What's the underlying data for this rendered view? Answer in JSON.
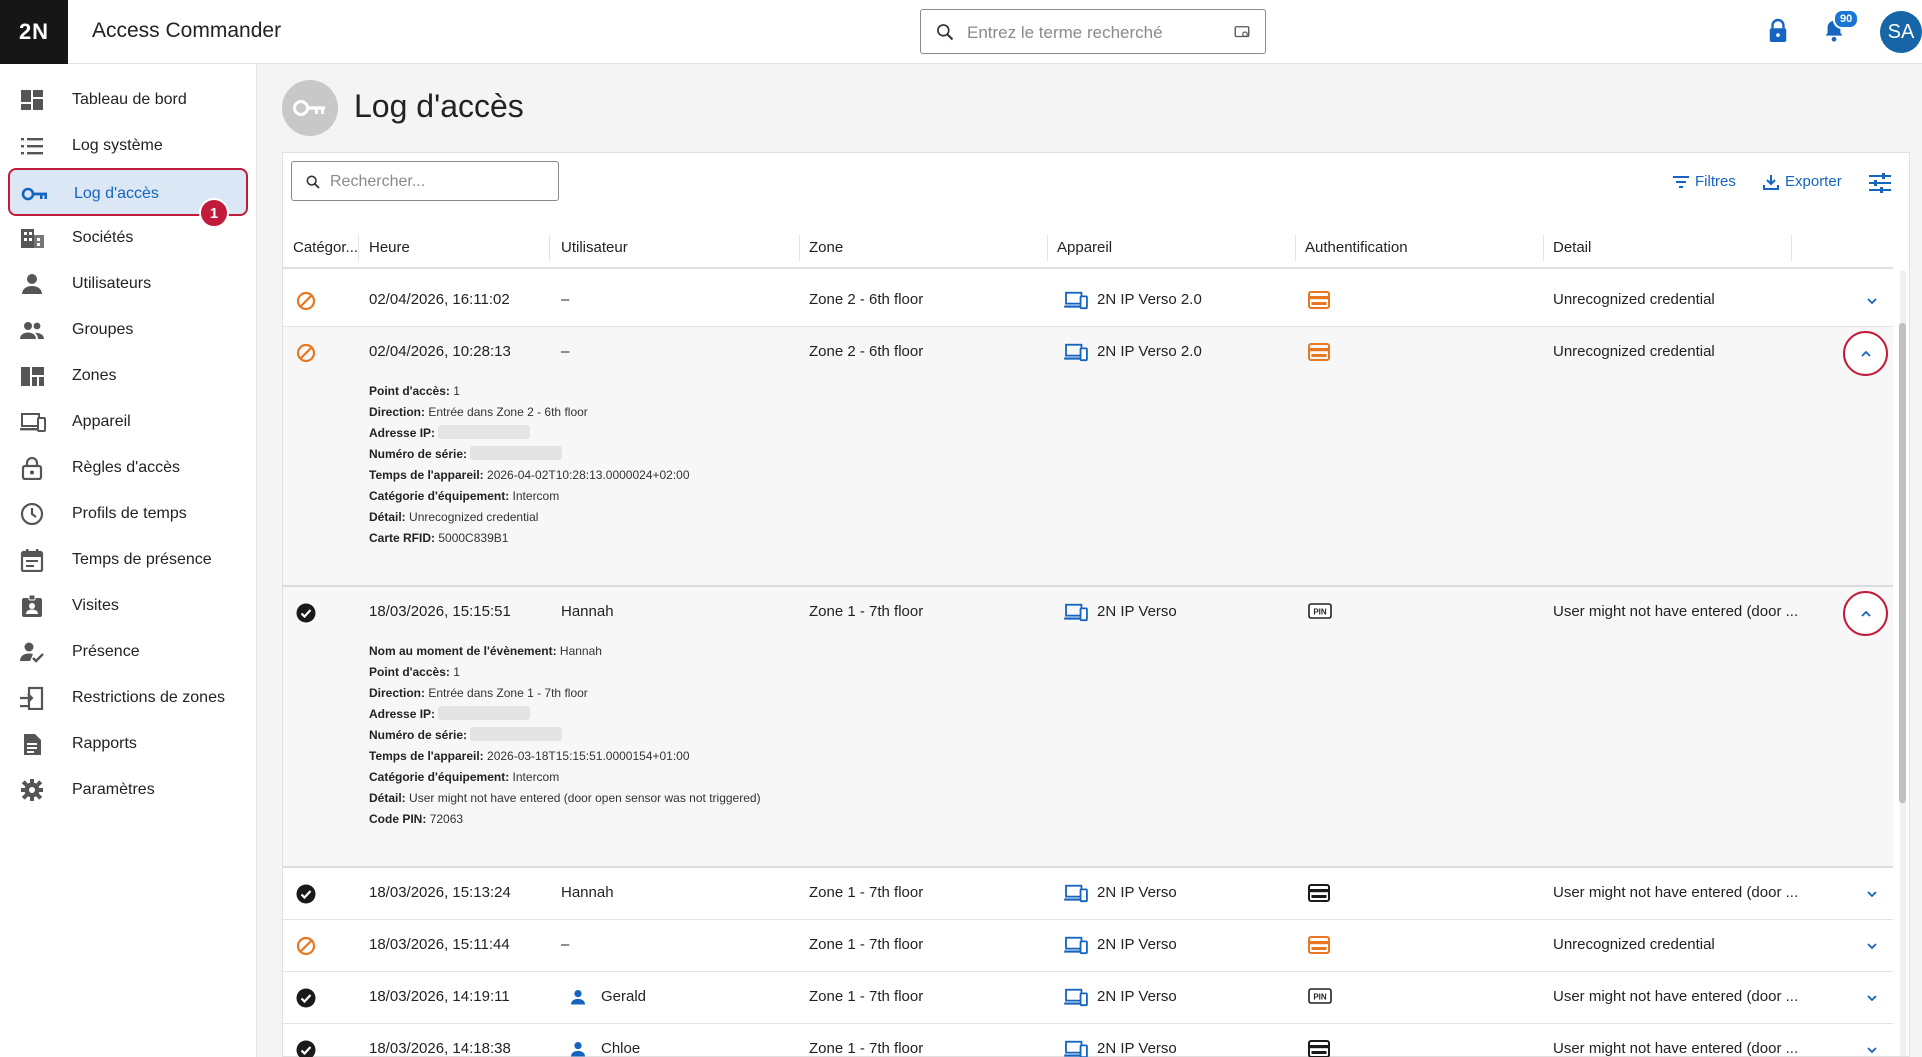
{
  "app": {
    "logo": "2N",
    "title": "Access Commander",
    "notifications_count": "90",
    "avatar_initials": "SA"
  },
  "global_search": {
    "placeholder": "Entrez le terme recherché"
  },
  "sidebar": {
    "items": [
      {
        "label": "Tableau de bord",
        "icon": "dashboard-icon"
      },
      {
        "label": "Log système",
        "icon": "list-icon"
      },
      {
        "label": "Log d'accès",
        "icon": "key-icon",
        "active": true,
        "step_badge": "1"
      },
      {
        "label": "Sociétés",
        "icon": "building-icon"
      },
      {
        "label": "Utilisateurs",
        "icon": "user-icon"
      },
      {
        "label": "Groupes",
        "icon": "group-icon"
      },
      {
        "label": "Zones",
        "icon": "zones-icon"
      },
      {
        "label": "Appareil",
        "icon": "devices-icon"
      },
      {
        "label": "Règles d'accès",
        "icon": "lock-icon"
      },
      {
        "label": "Profils de temps",
        "icon": "clock-icon"
      },
      {
        "label": "Temps de présence",
        "icon": "calendar-icon"
      },
      {
        "label": "Visites",
        "icon": "badge-icon"
      },
      {
        "label": "Présence",
        "icon": "person-check-icon"
      },
      {
        "label": "Restrictions de zones",
        "icon": "zone-restriction-icon"
      },
      {
        "label": "Rapports",
        "icon": "report-icon"
      },
      {
        "label": "Paramètres",
        "icon": "gear-icon"
      }
    ]
  },
  "page": {
    "title": "Log d'accès",
    "icon": "key-icon"
  },
  "toolbar": {
    "search_placeholder": "Rechercher...",
    "filters_label": "Filtres",
    "export_label": "Exporter"
  },
  "table": {
    "headers": [
      "Catégor...",
      "Heure",
      "Utilisateur",
      "Zone",
      "Appareil",
      "Authentification",
      "Detail"
    ],
    "rows": [
      {
        "category": "denied",
        "time": "02/04/2026, 16:11:02",
        "user": "–",
        "zone": "Zone 2 - 6th floor",
        "device": "2N IP Verso 2.0",
        "auth": "card-orange",
        "detail": "Unrecognized credential",
        "expanded": false
      },
      {
        "category": "denied",
        "time": "02/04/2026, 10:28:13",
        "user": "–",
        "zone": "Zone 2 - 6th floor",
        "device": "2N IP Verso 2.0",
        "auth": "card-orange",
        "detail": "Unrecognized credential",
        "expanded": true,
        "details": [
          {
            "label": "Point d'accès:",
            "value": "1"
          },
          {
            "label": "Direction:",
            "value": "Entrée dans Zone 2 - 6th floor"
          },
          {
            "label": "Adresse IP:",
            "value": ""
          },
          {
            "label": "Numéro de série:",
            "value": ""
          },
          {
            "label": "Temps de l'appareil:",
            "value": "2026-04-02T10:28:13.0000024+02:00"
          },
          {
            "label": "Catégorie d'équipement:",
            "value": "Intercom"
          },
          {
            "label": "Détail:",
            "value": "Unrecognized credential"
          },
          {
            "label": "Carte RFID:",
            "value": "5000C839B1"
          }
        ]
      },
      {
        "category": "granted",
        "time": "18/03/2026, 15:15:51",
        "user": "Hannah",
        "zone": "Zone 1 - 7th floor",
        "device": "2N IP Verso",
        "auth": "pin",
        "detail": "User might not have entered (door ...",
        "expanded": true,
        "details": [
          {
            "label": "Nom au moment de l'évènement:",
            "value": "Hannah"
          },
          {
            "label": "Point d'accès:",
            "value": "1"
          },
          {
            "label": "Direction:",
            "value": "Entrée dans Zone 1 - 7th floor"
          },
          {
            "label": "Adresse IP:",
            "value": ""
          },
          {
            "label": "Numéro de série:",
            "value": ""
          },
          {
            "label": "Temps de l'appareil:",
            "value": "2026-03-18T15:15:51.0000154+01:00"
          },
          {
            "label": "Catégorie d'équipement:",
            "value": "Intercom"
          },
          {
            "label": "Détail:",
            "value": "User might not have entered (door open sensor was not triggered)"
          },
          {
            "label": "Code PIN:",
            "value": "72063"
          }
        ]
      },
      {
        "category": "granted",
        "time": "18/03/2026, 15:13:24",
        "user": "Hannah",
        "zone": "Zone 1 - 7th floor",
        "device": "2N IP Verso",
        "auth": "card-black",
        "detail": "User might not have entered (door ...",
        "expanded": false
      },
      {
        "category": "denied",
        "time": "18/03/2026, 15:11:44",
        "user": "–",
        "zone": "Zone 1 - 7th floor",
        "device": "2N IP Verso",
        "auth": "card-orange",
        "detail": "Unrecognized credential",
        "expanded": false
      },
      {
        "category": "granted",
        "time": "18/03/2026, 14:19:11",
        "user": "Gerald",
        "user_icon": true,
        "zone": "Zone 1 - 7th floor",
        "device": "2N IP Verso",
        "auth": "pin",
        "detail": "User might not have entered (door ...",
        "expanded": false
      },
      {
        "category": "granted",
        "time": "18/03/2026, 14:18:38",
        "user": "Chloe",
        "user_icon": true,
        "zone": "Zone 1 - 7th floor",
        "device": "2N IP Verso",
        "auth": "card-black",
        "detail": "User might not have entered (door ...",
        "expanded": false
      }
    ]
  },
  "colors": {
    "accent": "#1565c0",
    "denied": "#e87722",
    "highlight": "#c21a3a",
    "active_bg": "#dbe7f5"
  }
}
